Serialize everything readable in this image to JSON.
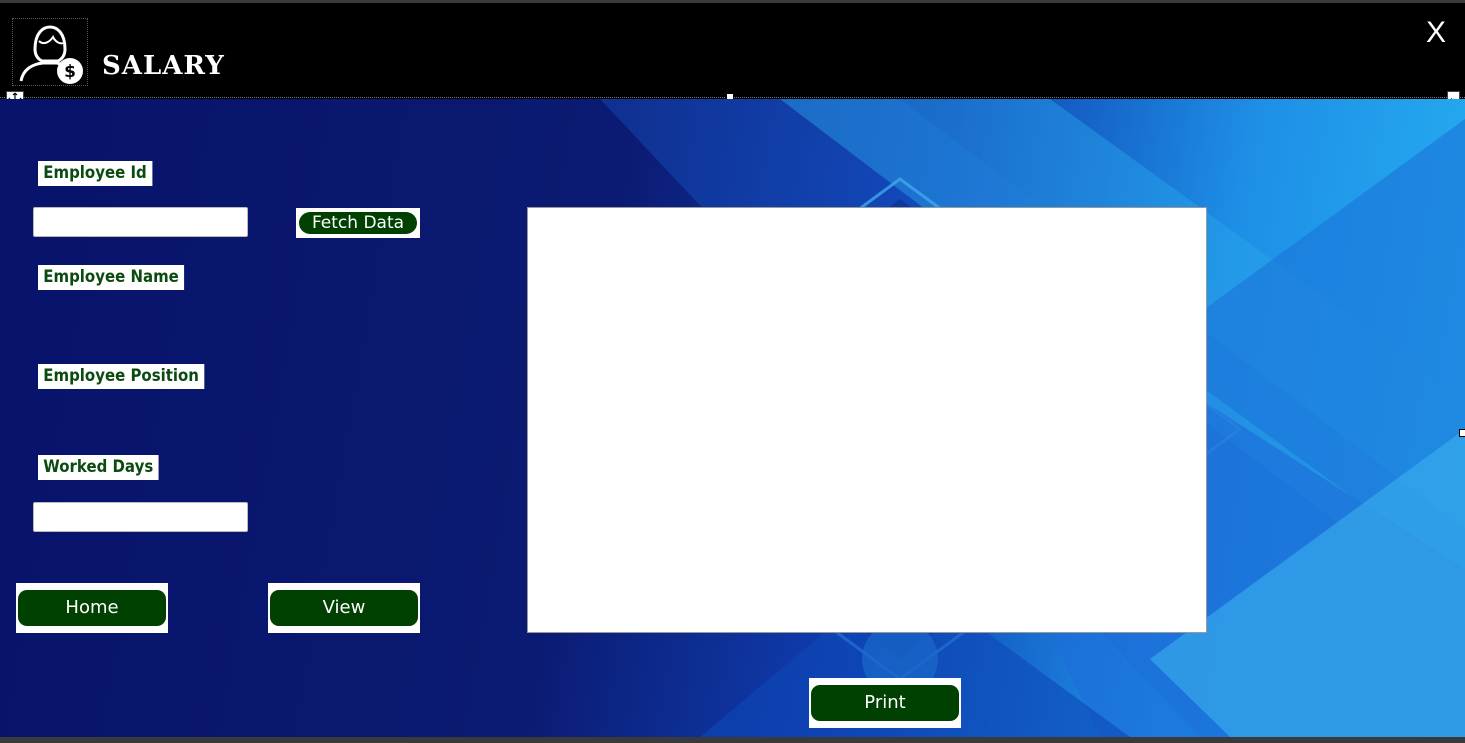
{
  "window": {
    "title": "SALARY",
    "close_label": "X",
    "logo_icon": "employee-salary-icon"
  },
  "form": {
    "employee_id_label": "Employee Id",
    "employee_id_value": "",
    "fetch_button": "Fetch Data",
    "employee_name_label": "Employee Name",
    "employee_position_label": "Employee Position",
    "worked_days_label": "Worked Days",
    "worked_days_value": ""
  },
  "buttons": {
    "home": "Home",
    "view": "View",
    "print": "Print"
  },
  "colors": {
    "button_bg": "#004000",
    "label_text": "#0b4a10",
    "titlebar_bg": "#000000",
    "panel_dark": "#08136a",
    "panel_light": "#27b4f2"
  }
}
